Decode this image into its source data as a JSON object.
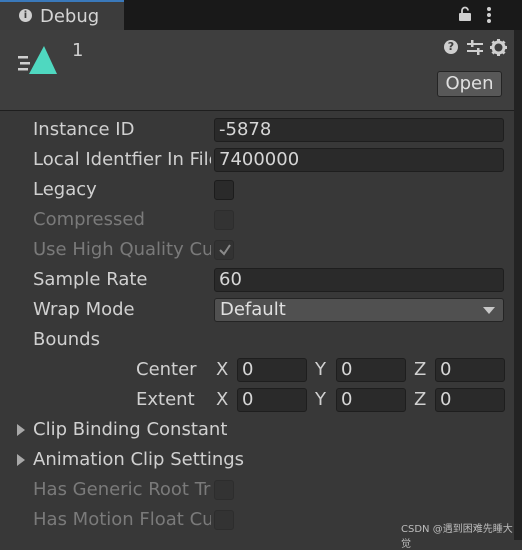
{
  "tab": {
    "title": "Debug",
    "info_icon": "i",
    "lock_icon": "lock-icon",
    "menu_icon": "kebab-icon"
  },
  "header": {
    "asset_name": "1",
    "help_icon": "?",
    "open_label": "Open",
    "asset_icon_color": "#4fd8c0"
  },
  "props": {
    "instance_id": {
      "label": "Instance ID",
      "value": "-5878"
    },
    "local_identifier": {
      "label": "Local Identfier In File",
      "value": "7400000"
    },
    "legacy": {
      "label": "Legacy",
      "checked": false
    },
    "compressed": {
      "label": "Compressed",
      "checked": false,
      "disabled": true
    },
    "high_quality": {
      "label": "Use High Quality Curve",
      "checked": true,
      "disabled": true
    },
    "sample_rate": {
      "label": "Sample Rate",
      "value": "60"
    },
    "wrap_mode": {
      "label": "Wrap Mode",
      "value": "Default"
    },
    "bounds": {
      "label": "Bounds"
    },
    "center": {
      "label": "Center",
      "x_label": "X",
      "x": "0",
      "y_label": "Y",
      "y": "0",
      "z_label": "Z",
      "z": "0"
    },
    "extent": {
      "label": "Extent",
      "x_label": "X",
      "x": "0",
      "y_label": "Y",
      "y": "0",
      "z_label": "Z",
      "z": "0"
    },
    "clip_binding": {
      "label": "Clip Binding Constant"
    },
    "clip_settings": {
      "label": "Animation Clip Settings"
    },
    "has_generic_root": {
      "label": "Has Generic Root Transform",
      "disabled": true
    },
    "has_motion_float": {
      "label": "Has Motion Float Curves",
      "disabled": true
    }
  },
  "watermark": "CSDN @遇到困难先睡大觉"
}
